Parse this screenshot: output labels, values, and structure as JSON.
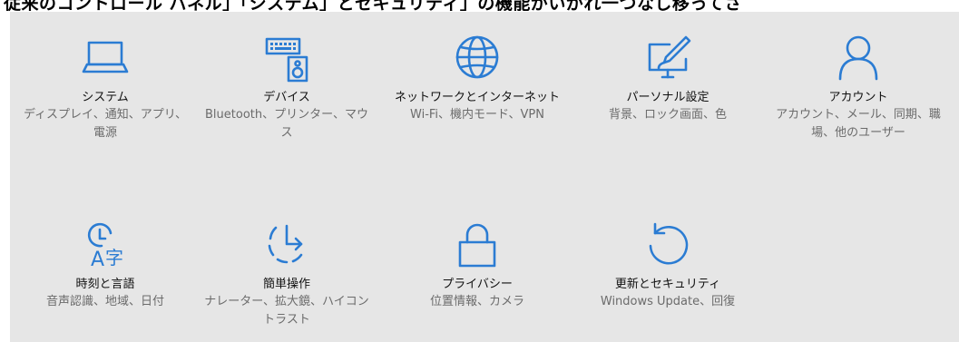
{
  "top_text": "従来のコントロール パネル」「システム」とセキュリティ」の機能がいがれ一つなし移ってさ",
  "accent_color": "#2b7cd3",
  "tiles": [
    {
      "icon": "laptop-icon",
      "title": "システム",
      "desc": "ディスプレイ、通知、アプリ、電源"
    },
    {
      "icon": "keyboard-speaker-icon",
      "title": "デバイス",
      "desc": "Bluetooth、プリンター、マウス"
    },
    {
      "icon": "globe-icon",
      "title": "ネットワークとインターネット",
      "desc": "Wi-Fi、機内モード、VPN"
    },
    {
      "icon": "paint-monitor-icon",
      "title": "パーソナル設定",
      "desc": "背景、ロック画面、色"
    },
    {
      "icon": "person-icon",
      "title": "アカウント",
      "desc": "アカウント、メール、同期、職場、他のユーザー"
    },
    {
      "icon": "clock-language-icon",
      "title": "時刻と言語",
      "desc": "音声認識、地域、日付"
    },
    {
      "icon": "ease-of-access-icon",
      "title": "簡単操作",
      "desc": "ナレーター、拡大鏡、ハイコントラスト"
    },
    {
      "icon": "lock-icon",
      "title": "プライバシー",
      "desc": "位置情報、カメラ"
    },
    {
      "icon": "refresh-icon",
      "title": "更新とセキュリティ",
      "desc": "Windows Update、回復"
    }
  ]
}
